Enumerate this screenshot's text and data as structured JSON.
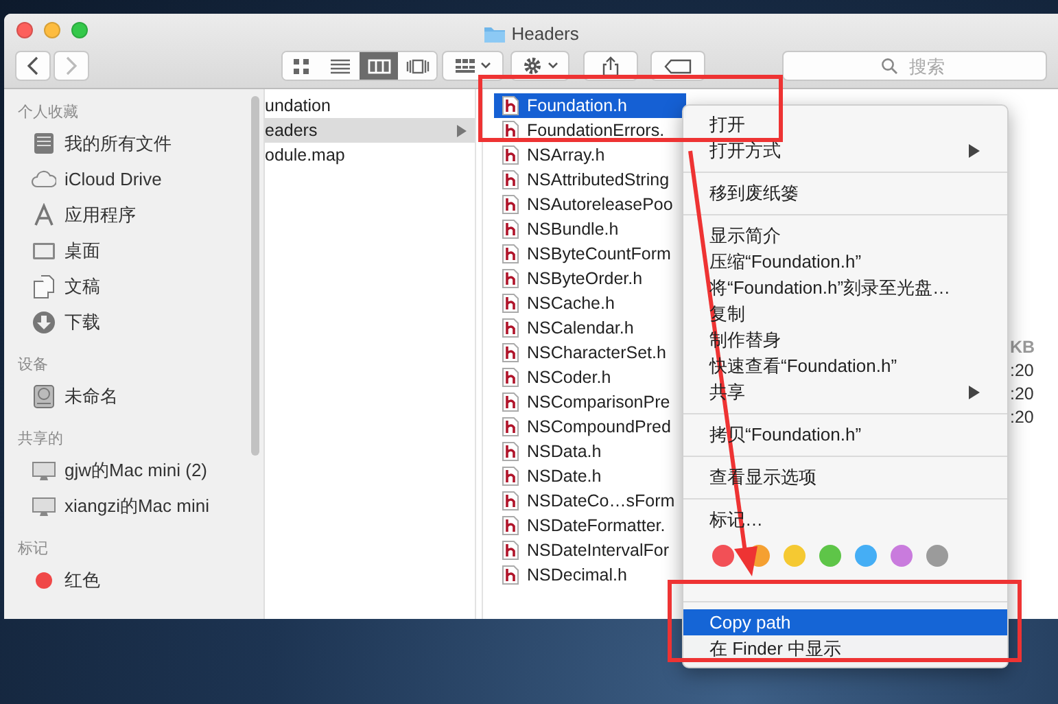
{
  "window": {
    "title": "Headers"
  },
  "toolbar": {
    "view_modes": [
      {
        "selected": false
      },
      {
        "selected": false
      },
      {
        "selected": true
      },
      {
        "selected": false
      }
    ],
    "search": {
      "placeholder": "搜索"
    }
  },
  "sidebar": {
    "sections": [
      {
        "heading": "个人收藏",
        "items": [
          {
            "label": "我的所有文件"
          },
          {
            "label": "iCloud Drive"
          },
          {
            "label": "应用程序"
          },
          {
            "label": "桌面"
          },
          {
            "label": "文稿"
          },
          {
            "label": "下载"
          }
        ]
      },
      {
        "heading": "设备",
        "items": [
          {
            "label": "未命名"
          }
        ]
      },
      {
        "heading": "共享的",
        "items": [
          {
            "label": "gjw的Mac mini (2)"
          },
          {
            "label": "xiangzi的Mac mini"
          }
        ]
      },
      {
        "heading": "标记",
        "items": [
          {
            "label": "红色",
            "color": "#f04848"
          }
        ]
      }
    ]
  },
  "column_1": [
    {
      "label": "undation",
      "selected": false
    },
    {
      "label": "eaders",
      "selected": true
    },
    {
      "label": "odule.map",
      "selected": false
    }
  ],
  "column_2": [
    {
      "label": "Foundation.h",
      "selected": true
    },
    {
      "label": "FoundationErrors.",
      "selected": false
    },
    {
      "label": "NSArray.h",
      "selected": false
    },
    {
      "label": "NSAttributedString",
      "selected": false
    },
    {
      "label": "NSAutoreleasePoo",
      "selected": false
    },
    {
      "label": "NSBundle.h",
      "selected": false
    },
    {
      "label": "NSByteCountForm",
      "selected": false
    },
    {
      "label": "NSByteOrder.h",
      "selected": false
    },
    {
      "label": "NSCache.h",
      "selected": false
    },
    {
      "label": "NSCalendar.h",
      "selected": false
    },
    {
      "label": "NSCharacterSet.h",
      "selected": false
    },
    {
      "label": "NSCoder.h",
      "selected": false
    },
    {
      "label": "NSComparisonPre",
      "selected": false
    },
    {
      "label": "NSCompoundPred",
      "selected": false
    },
    {
      "label": "NSData.h",
      "selected": false
    },
    {
      "label": "NSDate.h",
      "selected": false
    },
    {
      "label": "NSDateCo…sForm",
      "selected": false
    },
    {
      "label": "NSDateFormatter.",
      "selected": false
    },
    {
      "label": "NSDateIntervalFor",
      "selected": false
    },
    {
      "label": "NSDecimal.h",
      "selected": false
    }
  ],
  "preview": [
    "KB",
    ":20",
    ":20",
    ":20"
  ],
  "context_menu": [
    {
      "kind": "item",
      "label": "打开",
      "submenu": false,
      "selected": false
    },
    {
      "kind": "item",
      "label": "打开方式",
      "submenu": true,
      "selected": false
    },
    {
      "kind": "separator"
    },
    {
      "kind": "item",
      "label": "移到废纸篓",
      "submenu": false,
      "selected": false
    },
    {
      "kind": "separator"
    },
    {
      "kind": "item",
      "label": "显示简介",
      "submenu": false,
      "selected": false
    },
    {
      "kind": "item",
      "label": "压缩“Foundation.h”",
      "submenu": false,
      "selected": false
    },
    {
      "kind": "item",
      "label": "将“Foundation.h”刻录至光盘…",
      "submenu": false,
      "selected": false
    },
    {
      "kind": "item",
      "label": "复制",
      "submenu": false,
      "selected": false
    },
    {
      "kind": "item",
      "label": "制作替身",
      "submenu": false,
      "selected": false
    },
    {
      "kind": "item",
      "label": "快速查看“Foundation.h”",
      "submenu": false,
      "selected": false
    },
    {
      "kind": "item",
      "label": "共享",
      "submenu": true,
      "selected": false
    },
    {
      "kind": "separator"
    },
    {
      "kind": "item",
      "label": "拷贝“Foundation.h”",
      "submenu": false,
      "selected": false
    },
    {
      "kind": "separator"
    },
    {
      "kind": "item",
      "label": "查看显示选项",
      "submenu": false,
      "selected": false
    },
    {
      "kind": "separator"
    },
    {
      "kind": "item",
      "label": "标记…",
      "submenu": false,
      "selected": false
    },
    {
      "kind": "tags",
      "tags": [
        {
          "color": "#f25056"
        },
        {
          "color": "#f5a031"
        },
        {
          "color": "#f5c932"
        },
        {
          "color": "#5ec548"
        },
        {
          "color": "#45aef5"
        },
        {
          "color": "#c97bdd"
        },
        {
          "color": "#9b9b9b"
        }
      ]
    },
    {
      "kind": "separator"
    },
    {
      "kind": "item",
      "label": "Copy path",
      "submenu": false,
      "selected": true
    },
    {
      "kind": "item",
      "label": "在 Finder 中显示",
      "submenu": false,
      "selected": false
    }
  ]
}
